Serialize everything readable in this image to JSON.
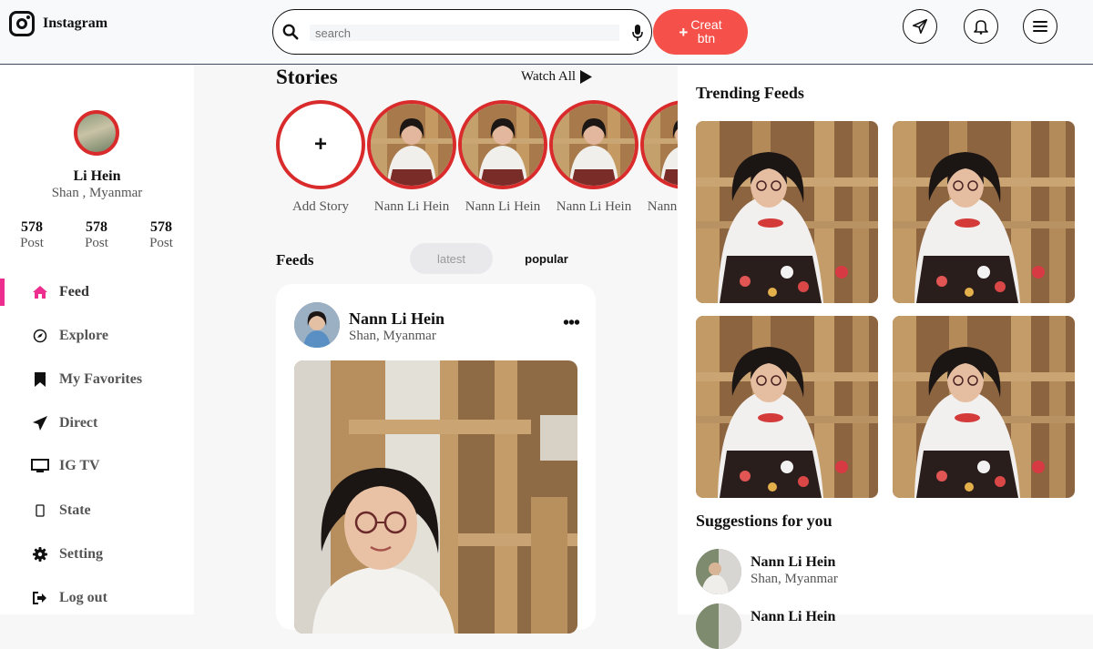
{
  "header": {
    "app_name": "Instagram",
    "search_placeholder": "search",
    "create_label_line1": "Creat",
    "create_label_line2": "btn",
    "icons": [
      "instagram-icon",
      "search-icon",
      "microphone-icon",
      "plus-icon",
      "send-icon",
      "bell-icon",
      "menu-icon"
    ]
  },
  "profile": {
    "name": "Li Hein",
    "location": "Shan , Myanmar",
    "stats": [
      {
        "value": "578",
        "label": "Post"
      },
      {
        "value": "578",
        "label": "Post"
      },
      {
        "value": "578",
        "label": "Post"
      }
    ]
  },
  "nav": [
    {
      "label": "Feed",
      "icon": "home-icon",
      "active": true
    },
    {
      "label": "Explore",
      "icon": "compass-icon"
    },
    {
      "label": "My Favorites",
      "icon": "bookmark-icon"
    },
    {
      "label": "Direct",
      "icon": "send-icon"
    },
    {
      "label": "IG TV",
      "icon": "tv-icon"
    },
    {
      "label": "State",
      "icon": "mobile-icon"
    },
    {
      "label": "Setting",
      "icon": "gear-icon"
    },
    {
      "label": "Log out",
      "icon": "logout-icon"
    }
  ],
  "stories": {
    "title": "Stories",
    "watch_all": "Watch All",
    "add_label": "Add Story",
    "add_symbol": "+",
    "items": [
      "Nann Li Hein",
      "Nann Li Hein",
      "Nann Li Hein",
      "Nann Li Hein"
    ]
  },
  "feeds": {
    "title": "Feeds",
    "tab_latest": "latest",
    "tab_popular": "popular",
    "post": {
      "name": "Nann Li Hein",
      "location": "Shan, Myanmar",
      "more": "•••"
    }
  },
  "right": {
    "trending_title": "Trending Feeds",
    "suggestions_title": "Suggestions for you",
    "suggestions": [
      {
        "name": "Nann Li Hein",
        "location": "Shan, Myanmar"
      },
      {
        "name": "Nann Li Hein",
        "location": ""
      }
    ]
  },
  "colors": {
    "accent": "#f5514a",
    "story_ring": "#d92b2b",
    "active_nav": "#ee2e8e"
  }
}
